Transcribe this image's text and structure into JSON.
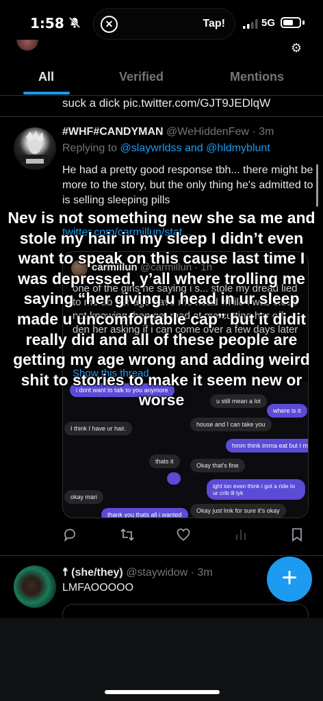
{
  "status_bar": {
    "time": "1:58",
    "island_label": "Tap!",
    "network": "5G"
  },
  "tabs": [
    {
      "label": "All",
      "active": true
    },
    {
      "label": "Verified",
      "active": false
    },
    {
      "label": "Mentions",
      "active": false
    }
  ],
  "previous_tweet_tail": "suck a dick pic.twitter.com/GJT9JEDlqW",
  "tweet1": {
    "display_name": "#WHF#CANDYMAN",
    "handle": "@WeHiddenFew",
    "time": "· 3m",
    "replying_prefix": "Replying to",
    "replying_users": "@slaywrldss and @hldmyblunt",
    "body": "He had a pretty good response tbh... there might be more to the story, but the only thing he's admitted to is selling sleeping pills",
    "link": "twitter.com/carmillun/stat...",
    "quote": {
      "author": "carmillun",
      "handle": "@carmillun · 1h",
      "text": "one of the girls he saying i s... stole my dread lied to me ab her age gave me head while i was sleep not knowing then get mad at me cutting her off den her asking if i can come over a few days later",
      "show_thread": "Show this thread",
      "chat": [
        {
          "from": "me",
          "text": "i dont want to talk to you anymore"
        },
        {
          "from": "them",
          "text": "u still mean a lot"
        },
        {
          "from": "me",
          "text": "where is it"
        },
        {
          "from": "them",
          "text": "I think I have ur hair."
        },
        {
          "from": "them",
          "text": "house and I can take you"
        },
        {
          "from": "me",
          "text": "hmm think imma eat but I might"
        },
        {
          "from": "them",
          "text": "thats it"
        },
        {
          "from": "them",
          "text": "Okay that's fine"
        },
        {
          "from": "me",
          "text": "ight ion even think i got a ride to ur crib ill lyk"
        },
        {
          "from": "them",
          "text": "okay mari"
        },
        {
          "from": "me",
          "text": "thank you thats all i wanted"
        },
        {
          "from": "them",
          "text": "Okay just lmk for sure it's okay"
        }
      ]
    }
  },
  "tweet2": {
    "display_name": "☨ (she/they)",
    "handle": "@staywidow",
    "time": "· 3m",
    "body": "LMFAOOOOO"
  },
  "overlay_caption": "Nev is not something new she sa me and stole my hair in my sleep I didn’t even want to speak on this cause last time I was depressed, y’all where trolling me saying “her giving u head in ur sleep made u uncomfortable cap” but it didit really did and all of these people are getting my age wrong and adding weird shit to stories to make it seem new or worse",
  "icons": {
    "reply": "reply-icon",
    "retweet": "retweet-icon",
    "like": "heart-icon",
    "views": "analytics-icon",
    "bookmark": "bookmark-icon",
    "compose": "compose-plus-icon"
  },
  "colors": {
    "accent": "#1d9bf0",
    "background": "#000000",
    "muted": "#71767b",
    "chat_me": "#5b4bd6"
  }
}
